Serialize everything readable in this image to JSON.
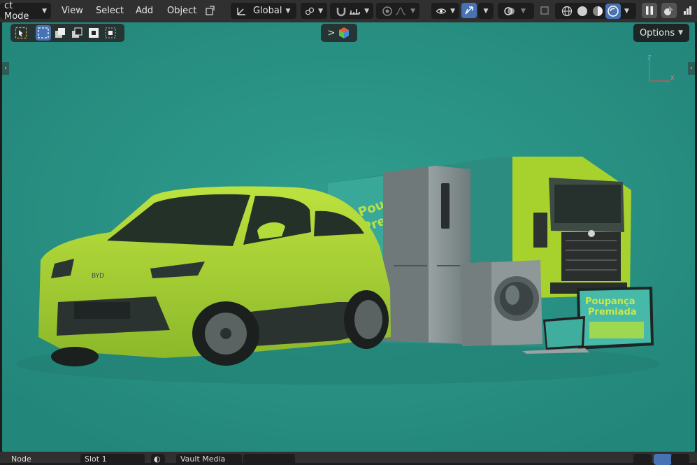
{
  "header": {
    "mode_label": "ct Mode",
    "menus": [
      "View",
      "Select",
      "Add",
      "Object"
    ],
    "orientation_label": "Global",
    "chevron": "⌄"
  },
  "viewport_header": {
    "options_label": "Options"
  },
  "gizmo": {
    "z_label": "Z",
    "x_label": "X"
  },
  "scene": {
    "car_badge": "BYD",
    "billboard_title_1": "Poupança",
    "billboard_title_2": "Premiada",
    "truck_sign_1": "Poupa",
    "truck_sign_2": "Prem"
  },
  "status_bar": {
    "items": [
      "Node",
      "Slot 1",
      "Vault Media"
    ]
  },
  "colors": {
    "header_bg": "#303030",
    "widget_bg": "#1d1d1d",
    "active_blue": "#4772b3",
    "viewport_bg": "#2b9686",
    "lime": "#a8d633"
  }
}
